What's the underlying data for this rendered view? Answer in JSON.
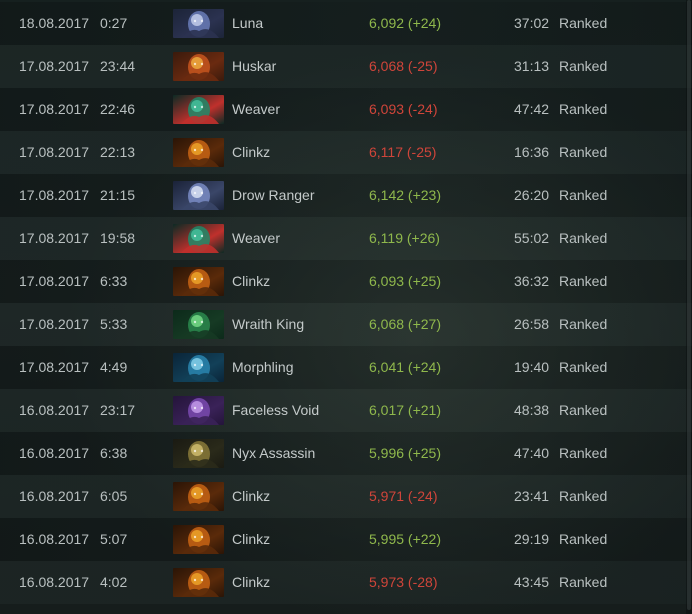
{
  "matches": [
    {
      "date": "18.08.2017",
      "time": "0:27",
      "hero": "Luna",
      "portrait": "luna-portrait",
      "mmr": "6,092 (+24)",
      "result": "win",
      "duration": "37:02",
      "type": "Ranked"
    },
    {
      "date": "17.08.2017",
      "time": "23:44",
      "hero": "Huskar",
      "portrait": "huskar-portrait",
      "mmr": "6,068 (-25)",
      "result": "loss",
      "duration": "31:13",
      "type": "Ranked"
    },
    {
      "date": "17.08.2017",
      "time": "22:46",
      "hero": "Weaver",
      "portrait": "weaver-portrait",
      "mmr": "6,093 (-24)",
      "result": "loss",
      "duration": "47:42",
      "type": "Ranked"
    },
    {
      "date": "17.08.2017",
      "time": "22:13",
      "hero": "Clinkz",
      "portrait": "clinkz-portrait",
      "mmr": "6,117 (-25)",
      "result": "loss",
      "duration": "16:36",
      "type": "Ranked"
    },
    {
      "date": "17.08.2017",
      "time": "21:15",
      "hero": "Drow Ranger",
      "portrait": "drow-ranger-portrait",
      "mmr": "6,142 (+23)",
      "result": "win",
      "duration": "26:20",
      "type": "Ranked"
    },
    {
      "date": "17.08.2017",
      "time": "19:58",
      "hero": "Weaver",
      "portrait": "weaver-portrait",
      "mmr": "6,119 (+26)",
      "result": "win",
      "duration": "55:02",
      "type": "Ranked"
    },
    {
      "date": "17.08.2017",
      "time": "6:33",
      "hero": "Clinkz",
      "portrait": "clinkz-portrait",
      "mmr": "6,093 (+25)",
      "result": "win",
      "duration": "36:32",
      "type": "Ranked"
    },
    {
      "date": "17.08.2017",
      "time": "5:33",
      "hero": "Wraith King",
      "portrait": "wraith-king-portrait",
      "mmr": "6,068 (+27)",
      "result": "win",
      "duration": "26:58",
      "type": "Ranked"
    },
    {
      "date": "17.08.2017",
      "time": "4:49",
      "hero": "Morphling",
      "portrait": "morphling-portrait",
      "mmr": "6,041 (+24)",
      "result": "win",
      "duration": "19:40",
      "type": "Ranked"
    },
    {
      "date": "16.08.2017",
      "time": "23:17",
      "hero": "Faceless Void",
      "portrait": "faceless-void-portrait",
      "mmr": "6,017 (+21)",
      "result": "win",
      "duration": "48:38",
      "type": "Ranked"
    },
    {
      "date": "16.08.2017",
      "time": "6:38",
      "hero": "Nyx Assassin",
      "portrait": "nyx-assassin-portrait",
      "mmr": "5,996 (+25)",
      "result": "win",
      "duration": "47:40",
      "type": "Ranked"
    },
    {
      "date": "16.08.2017",
      "time": "6:05",
      "hero": "Clinkz",
      "portrait": "clinkz-portrait",
      "mmr": "5,971 (-24)",
      "result": "loss",
      "duration": "23:41",
      "type": "Ranked"
    },
    {
      "date": "16.08.2017",
      "time": "5:07",
      "hero": "Clinkz",
      "portrait": "clinkz-portrait",
      "mmr": "5,995 (+22)",
      "result": "win",
      "duration": "29:19",
      "type": "Ranked"
    },
    {
      "date": "16.08.2017",
      "time": "4:02",
      "hero": "Clinkz",
      "portrait": "clinkz-portrait",
      "mmr": "5,973 (-28)",
      "result": "loss",
      "duration": "43:45",
      "type": "Ranked"
    }
  ],
  "colors": {
    "win": "#8fb84c",
    "loss": "#d0453a",
    "text": "#b9c0c0",
    "background": "#17201f"
  },
  "portrait_palettes": {
    "luna": [
      "#1c2438",
      "#6a7cb8",
      "#c8d2ee",
      "#2b3250"
    ],
    "huskar": [
      "#3a1a0c",
      "#c8561e",
      "#f0b040",
      "#6a2a10"
    ],
    "weaver": [
      "#0c2a24",
      "#1e8a6a",
      "#46c4a0",
      "#c0302c"
    ],
    "clinkz": [
      "#2a1406",
      "#c86414",
      "#f0a82a",
      "#5a2a0a"
    ],
    "drow-ranger": [
      "#1a2238",
      "#7a8cc4",
      "#dfe6f6",
      "#3a4668"
    ],
    "wraith-king": [
      "#0c2a1a",
      "#2a8a4e",
      "#7ae08a",
      "#163a24"
    ],
    "morphling": [
      "#0a2438",
      "#2a86b0",
      "#8ad4ee",
      "#124058"
    ],
    "faceless-void": [
      "#24143a",
      "#7a4ab0",
      "#c8a0ee",
      "#3a2258"
    ],
    "nyx-assassin": [
      "#1a1a12",
      "#8a7a3a",
      "#d4c070",
      "#2a2a1a"
    ]
  }
}
